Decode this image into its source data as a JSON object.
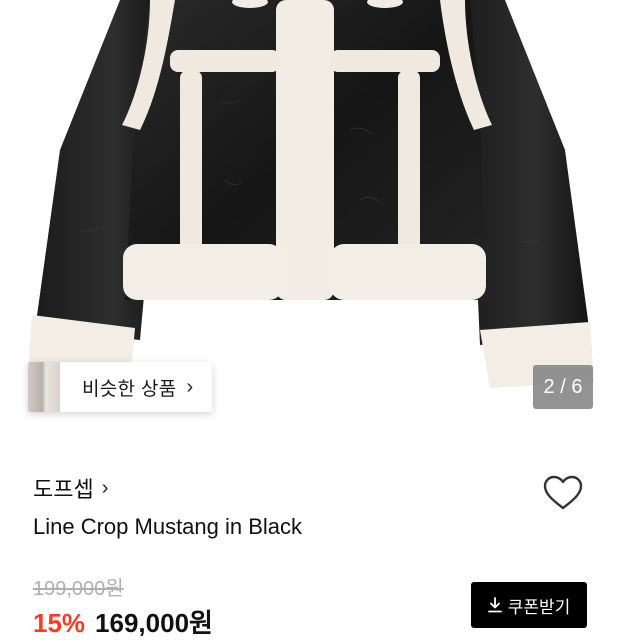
{
  "gallery": {
    "similar_label": "비슷한 상품",
    "pager_text": "2 / 6"
  },
  "product": {
    "brand": "도프셉",
    "title": "Line Crop Mustang in Black",
    "original_price": "199,000원",
    "discount": "15%",
    "sale_price": "169,000원"
  },
  "actions": {
    "coupon_label": "쿠폰받기"
  },
  "icons": {
    "brand_chevron": "chevron-right-icon",
    "like": "heart-outline-icon",
    "download": "download-icon"
  },
  "colors": {
    "discount": "#ff3b1f",
    "coupon_bg": "#000000",
    "pager_bg": "#8a8a8a",
    "struck_price": "#b0b0b0"
  }
}
